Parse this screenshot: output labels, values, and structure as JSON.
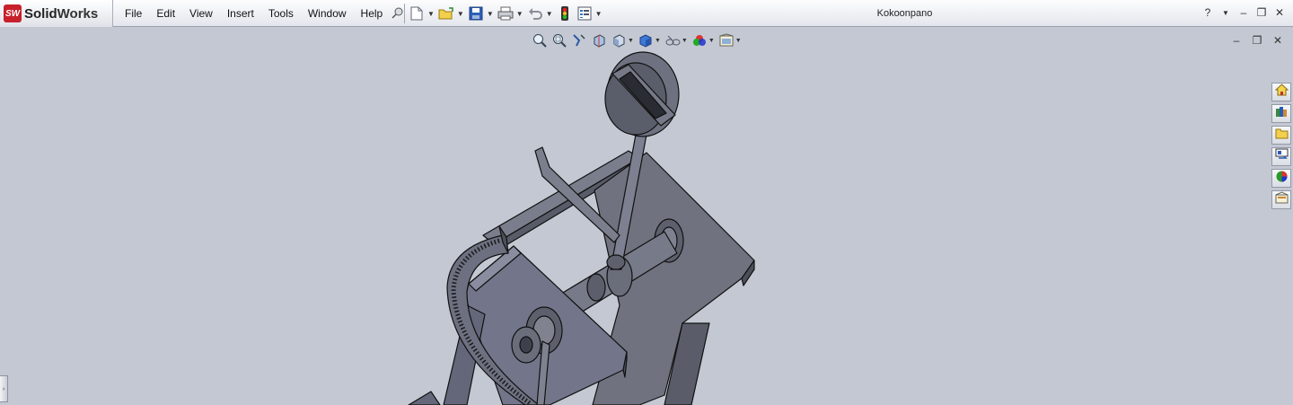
{
  "app": {
    "logo_text_bold": "Solid",
    "logo_text_rest": "Works",
    "logo_mark": "SW",
    "document_title": "Kokoonpano"
  },
  "menu": [
    {
      "label": "File"
    },
    {
      "label": "Edit"
    },
    {
      "label": "View"
    },
    {
      "label": "Insert"
    },
    {
      "label": "Tools"
    },
    {
      "label": "Window"
    },
    {
      "label": "Help"
    }
  ],
  "standard_toolbar": [
    "new-document-icon",
    "open-folder-icon",
    "save-icon",
    "print-icon",
    "undo-icon",
    "traffic-light-icon",
    "options-icon"
  ],
  "view_toolbar": [
    "zoom-to-fit-icon",
    "zoom-area-icon",
    "previous-view-icon",
    "section-view-icon",
    "view-orientation-icon",
    "display-style-icon",
    "hide-show-items-icon",
    "edit-appearance-icon",
    "apply-scene-icon"
  ],
  "task_pane": [
    "home-icon",
    "design-library-icon",
    "file-explorer-icon",
    "view-palette-icon",
    "appearances-icon",
    "custom-properties-icon"
  ],
  "window_controls": {
    "help": "?",
    "minimize": "–",
    "restore": "❐",
    "close": "✕"
  },
  "colors": {
    "viewport_bg": "#c3c8d2",
    "model_face": "#6e7180",
    "model_edge": "#111111",
    "brand_red": "#c8202a"
  }
}
